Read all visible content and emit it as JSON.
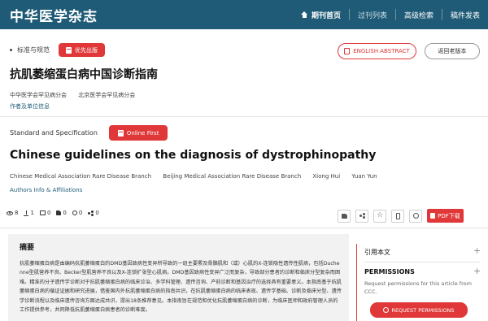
{
  "header": {
    "brand": "中华医学杂志",
    "nav": [
      {
        "label": "期刊首页",
        "icon": "home-icon"
      },
      {
        "label": "过刊列表"
      },
      {
        "label": "高级检索"
      },
      {
        "label": "稿件发表"
      }
    ]
  },
  "cn": {
    "category": "标准与规范",
    "online_first": "优先出版",
    "english_abstract_button": "ENGLISH ABSTRACT",
    "old_version_button": "返回老版本",
    "title": "抗肌萎缩蛋白病中国诊断指南",
    "authors": [
      "中华医学会罕见病分会",
      "北京医学会罕见病分会"
    ],
    "authors_link": "作者及单位信息"
  },
  "en": {
    "category": "Standard and Specification",
    "online_first": "Online First",
    "title": "Chinese guidelines on the diagnosis of dystrophinopathy",
    "authors": [
      "Chinese Medical Association Rare Disease Branch",
      "Beijing Medical Association Rare Disease Branch",
      "Xiong Hui",
      "Yuan Yun"
    ],
    "authors_link": "Authors Info & Affiliations"
  },
  "stats": {
    "views": "8",
    "downloads": "1",
    "comments": "0",
    "likes": "0",
    "collects": "0",
    "shares": "0"
  },
  "tools": {
    "pdf_button": "PDF下载"
  },
  "abstract": {
    "heading": "摘要",
    "text": "抗肌萎缩蛋白病是由编码抗肌萎缩蛋白的DMD基因致病性变异所导致的一组主要累及骨骼肌和（或）心肌的X-连锁隐性遗传性肌病，包括Duchenne型肌营养不良、Becker型肌营养不良以及X-连锁扩张型心肌病。DMD基因致病性变异广泛而复杂，导致部分患者的诊断和临床分型复杂而困难。精准的分子遗传学诊断对于抗肌萎缩蛋白病的临床诊治、多学科管理、遗传咨询、产前诊断和基因治疗的选择具有重要意义。本指南基于抗肌萎缩蛋白病的循证证据和研究进展，借鉴国内外抗肌萎缩蛋白病的指南共识，在抗肌萎缩蛋白病的临床表现、遗传学基础、诊断及临床分型、遗传学诊断流程以及临床遗传咨询方面达成共识，提出18条推荐意见。本指南旨在规范和优化抗肌萎缩蛋白病的诊断，为临床医师和政府管理人员的工作提供参考，共同降低抗肌萎缩蛋白病患者的诊断难度。"
  },
  "sidebar": {
    "cited_label": "引用本文",
    "permissions_title": "PERMISSIONS",
    "permissions_desc": "Request permissions for this article from CCC.",
    "request_button": "REQUEST PERMISSIONS"
  },
  "colors": {
    "header_bg": "#1f5b76",
    "accent_red": "#e03838",
    "link_blue": "#1f5b76"
  }
}
